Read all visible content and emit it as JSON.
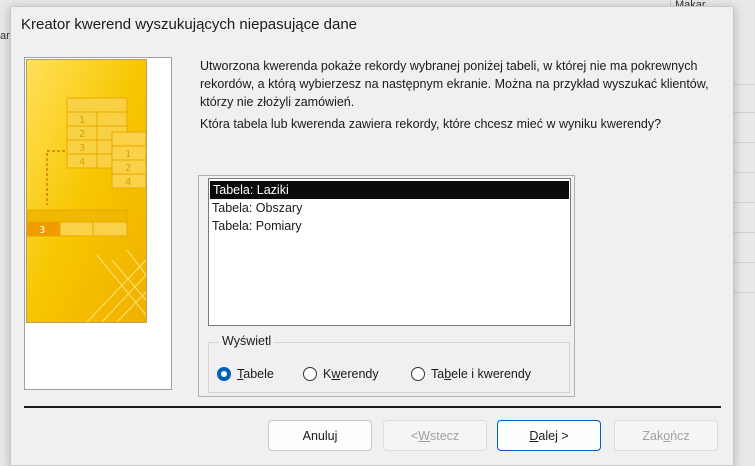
{
  "background": {
    "left_tab_text": "an",
    "right_cell_text": "Makar"
  },
  "dialog": {
    "title": "Kreator kwerend wyszukujących niepasujące dane",
    "intro": "Utworzona kwerenda pokaże rekordy wybranej poniżej tabeli, w której nie ma pokrewnych rekordów, a którą wybierzesz na następnym ekranie. Można na przykład wyszukać klientów, którzy nie złożyli zamówień.",
    "question": "Która tabela lub kwerenda zawiera rekordy, które chcesz mieć w wyniku kwerendy?",
    "illustration": {
      "left_numbers": [
        "1",
        "2",
        "3",
        "4"
      ],
      "right_numbers": [
        "1",
        "2",
        "4"
      ],
      "bottom_number": "3"
    },
    "list": {
      "items": [
        "Tabela: Laziki",
        "Tabela: Obszary",
        "Tabela: Pomiary"
      ],
      "selected_index": 0
    },
    "view_group": {
      "label": "Wyświetl",
      "options": [
        {
          "pre": "",
          "key": "T",
          "post": "abele",
          "checked": true
        },
        {
          "pre": "K",
          "key": "w",
          "post": "erendy",
          "checked": false
        },
        {
          "pre": "Ta",
          "key": "b",
          "post": "ele i kwerendy",
          "checked": false
        }
      ]
    },
    "buttons": {
      "cancel": "Anuluj",
      "back": {
        "pre": "< ",
        "key": "W",
        "post": "stecz"
      },
      "next": {
        "pre": "",
        "key": "D",
        "post": "alej >"
      },
      "finish": {
        "pre": "Zak",
        "key": "o",
        "post": "ńcz"
      }
    }
  },
  "colors": {
    "accent": "#005fb8",
    "illustration_yellow": "#f5c400",
    "selection": "#0a0a0a"
  }
}
